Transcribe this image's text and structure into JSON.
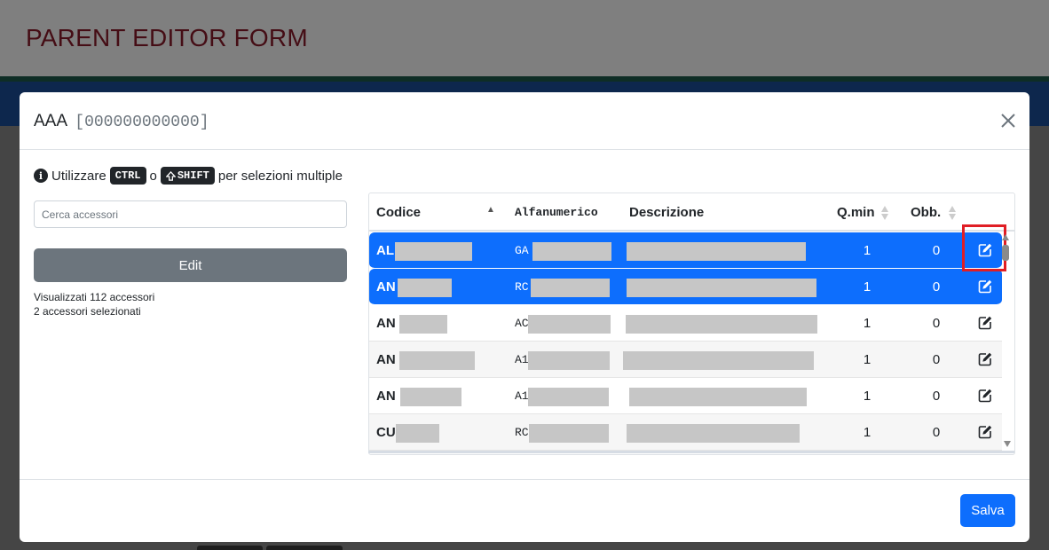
{
  "page": {
    "title": "PARENT EDITOR FORM"
  },
  "modal": {
    "title": "AAA",
    "code": "[000000000000]",
    "hint": {
      "prefix": "Utilizzare",
      "key1": "CTRL",
      "middle": "o",
      "key2": "SHIFT",
      "suffix": "per selezioni multiple"
    },
    "search_placeholder": "Cerca accessori",
    "edit_label": "Edit",
    "shown_count": "Visualizzati 112 accessori",
    "selected_count": "2 accessori selezionati",
    "save_label": "Salva"
  },
  "table": {
    "headers": {
      "codice": "Codice",
      "alfanumerico": "Alfanumerico",
      "descrizione": "Descrizione",
      "qmin": "Q.min",
      "obb": "Obb."
    },
    "rows": [
      {
        "code": "AL",
        "alpha": "GA",
        "qmin": "1",
        "obb": "0",
        "selected": true
      },
      {
        "code": "AN",
        "alpha": "RC",
        "qmin": "1",
        "obb": "0",
        "selected": true
      },
      {
        "code": "AN",
        "alpha": "AC",
        "qmin": "1",
        "obb": "0",
        "selected": false
      },
      {
        "code": "AN",
        "alpha": "A1",
        "qmin": "1",
        "obb": "0",
        "selected": false
      },
      {
        "code": "AN",
        "alpha": "A1",
        "qmin": "1",
        "obb": "0",
        "selected": false
      },
      {
        "code": "CU",
        "alpha": "RC",
        "qmin": "1",
        "obb": "0",
        "selected": false
      }
    ]
  },
  "colors": {
    "title": "#8b1a2b",
    "selected_row": "#0d6efd",
    "highlight": "#e01e25",
    "secondary_button": "#6c757d"
  },
  "icons": {
    "close": "close-icon",
    "info": "info-icon",
    "shift": "shift-icon",
    "edit": "edit-icon",
    "sort": "sort-icon"
  }
}
